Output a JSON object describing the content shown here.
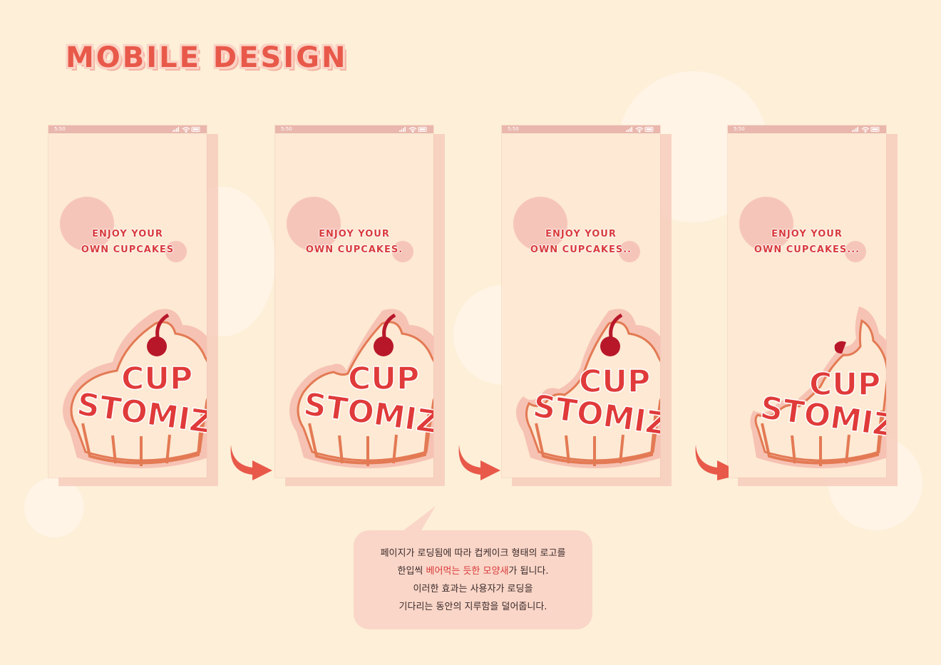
{
  "page": {
    "title": "MOBILE DESIGN"
  },
  "phones": [
    {
      "time": "5:50",
      "line1": "ENJOY YOUR",
      "line2": "OWN CUPCAKES",
      "cake_top": "CUP",
      "cake_bottom": "STOMIZE"
    },
    {
      "time": "5:50",
      "line1": "ENJOY YOUR",
      "line2": "OWN CUPCAKES.",
      "cake_top": "CUP",
      "cake_bottom": "STOMIZE"
    },
    {
      "time": "5:50",
      "line1": "ENJOY YOUR",
      "line2": "OWN CUPCAKES..",
      "cake_top": "CUP",
      "cake_bottom": "STOMIZE"
    },
    {
      "time": "5:50",
      "line1": "ENJOY YOUR",
      "line2": "OWN CUPCAKES...",
      "cake_top": "CUP",
      "cake_bottom": "STOMIZE"
    }
  ],
  "description": {
    "line1": "페이지가 로딩됨에 따라 컵케이크 형태의 로고를",
    "line2_before": "한입씩 ",
    "line2_highlight": "베어먹는 듯한 모양새",
    "line2_after": "가 됩니다.",
    "line3": "이러한 효과는 사용자가 로딩을",
    "line4": "기다리는 동안의 지루함을 덜어줍니다."
  },
  "colors": {
    "background": "#fdefd8",
    "accent": "#e8594a",
    "highlight": "#d93b3b",
    "bubble": "#fad6c8"
  },
  "icons": [
    "signal-icon",
    "wifi-icon",
    "battery-icon",
    "cherry-icon",
    "arrow-right-icon"
  ]
}
